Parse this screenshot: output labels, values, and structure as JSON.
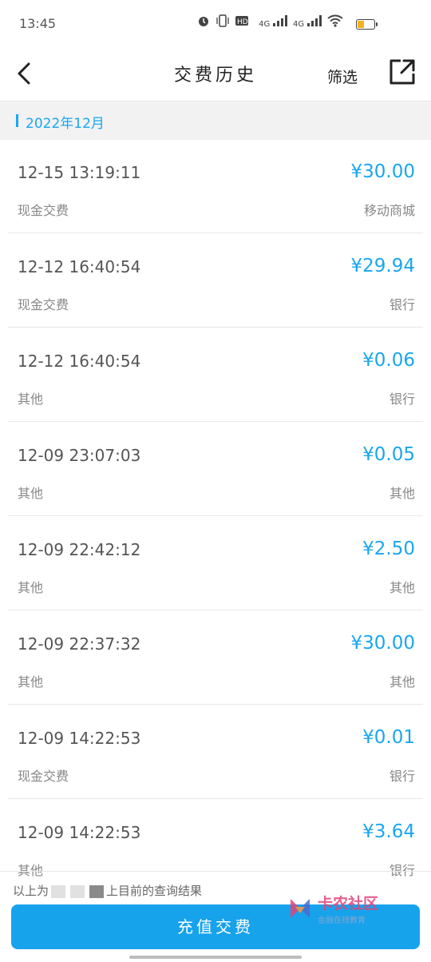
{
  "status_bar": {
    "time": "13:45",
    "icons": [
      "alarm-icon",
      "vibrate-icon",
      "hd-icon",
      "signal-4g-icon",
      "signal-4g-icon",
      "wifi-icon",
      "battery-icon"
    ],
    "net_label_1": "4G",
    "net_label_2": "4G",
    "battery_level": 0.35,
    "battery_color": "#f3b21b"
  },
  "nav": {
    "title": "交费历史",
    "filter_label": "筛选",
    "back_icon": "back-chevron-icon",
    "share_icon": "share-icon"
  },
  "month": {
    "label": "2022年12月",
    "accent_color": "#1aa6ef"
  },
  "records": [
    {
      "datetime": "12-15 13:19:11",
      "amount": "¥30.00",
      "type": "现金交费",
      "channel": "移动商城"
    },
    {
      "datetime": "12-12 16:40:54",
      "amount": "¥29.94",
      "type": "现金交费",
      "channel": "银行"
    },
    {
      "datetime": "12-12 16:40:54",
      "amount": "¥0.06",
      "type": "其他",
      "channel": "银行"
    },
    {
      "datetime": "12-09 23:07:03",
      "amount": "¥0.05",
      "type": "其他",
      "channel": "其他"
    },
    {
      "datetime": "12-09 22:42:12",
      "amount": "¥2.50",
      "type": "其他",
      "channel": "其他"
    },
    {
      "datetime": "12-09 22:37:32",
      "amount": "¥30.00",
      "type": "其他",
      "channel": "其他"
    },
    {
      "datetime": "12-09 14:22:53",
      "amount": "¥0.01",
      "type": "现金交费",
      "channel": "银行"
    },
    {
      "datetime": "12-09 14:22:53",
      "amount": "¥3.64",
      "type": "其他",
      "channel": "银行"
    }
  ],
  "footer": {
    "note_prefix": "以上为",
    "note_suffix": "上目前的查询结果",
    "button_label": "充值交费",
    "button_color": "#17a2ec"
  },
  "watermark": {
    "title": "卡农社区",
    "subtitle": "金融在线教育"
  }
}
